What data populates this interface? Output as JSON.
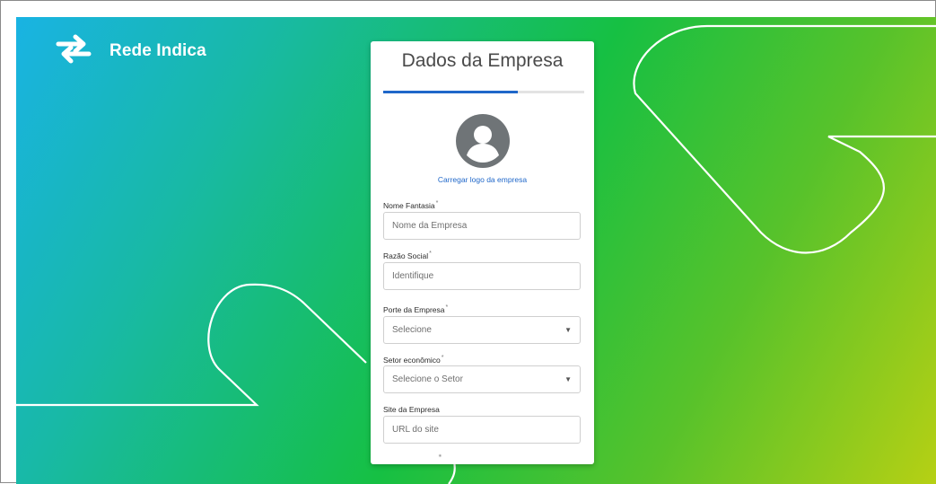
{
  "brand": {
    "name": "Rede Indica",
    "icon": "swap-arrows-icon"
  },
  "form": {
    "title": "Dados da Empresa",
    "progress_fraction": 0.67,
    "upload_logo_label": "Carregar logo da empresa",
    "required_marker": "*",
    "fields": [
      {
        "label": "Nome Fantasia",
        "placeholder": "Nome da Empresa",
        "type": "text",
        "required": true
      },
      {
        "label": "Razão Social",
        "placeholder": "Identifique",
        "type": "text",
        "required": true
      },
      {
        "label": "Porte da Empresa",
        "placeholder": "Selecione",
        "type": "select",
        "required": true
      },
      {
        "label": "Setor econômico",
        "placeholder": "Selecione o Setor",
        "type": "select",
        "required": true
      },
      {
        "label": "Site da Empresa",
        "placeholder": "URL do site",
        "type": "text",
        "required": false
      }
    ]
  },
  "colors": {
    "accent": "#1f67c9",
    "gradient_start": "#19b3e3",
    "gradient_mid": "#16c043",
    "gradient_end": "#b6d014"
  }
}
